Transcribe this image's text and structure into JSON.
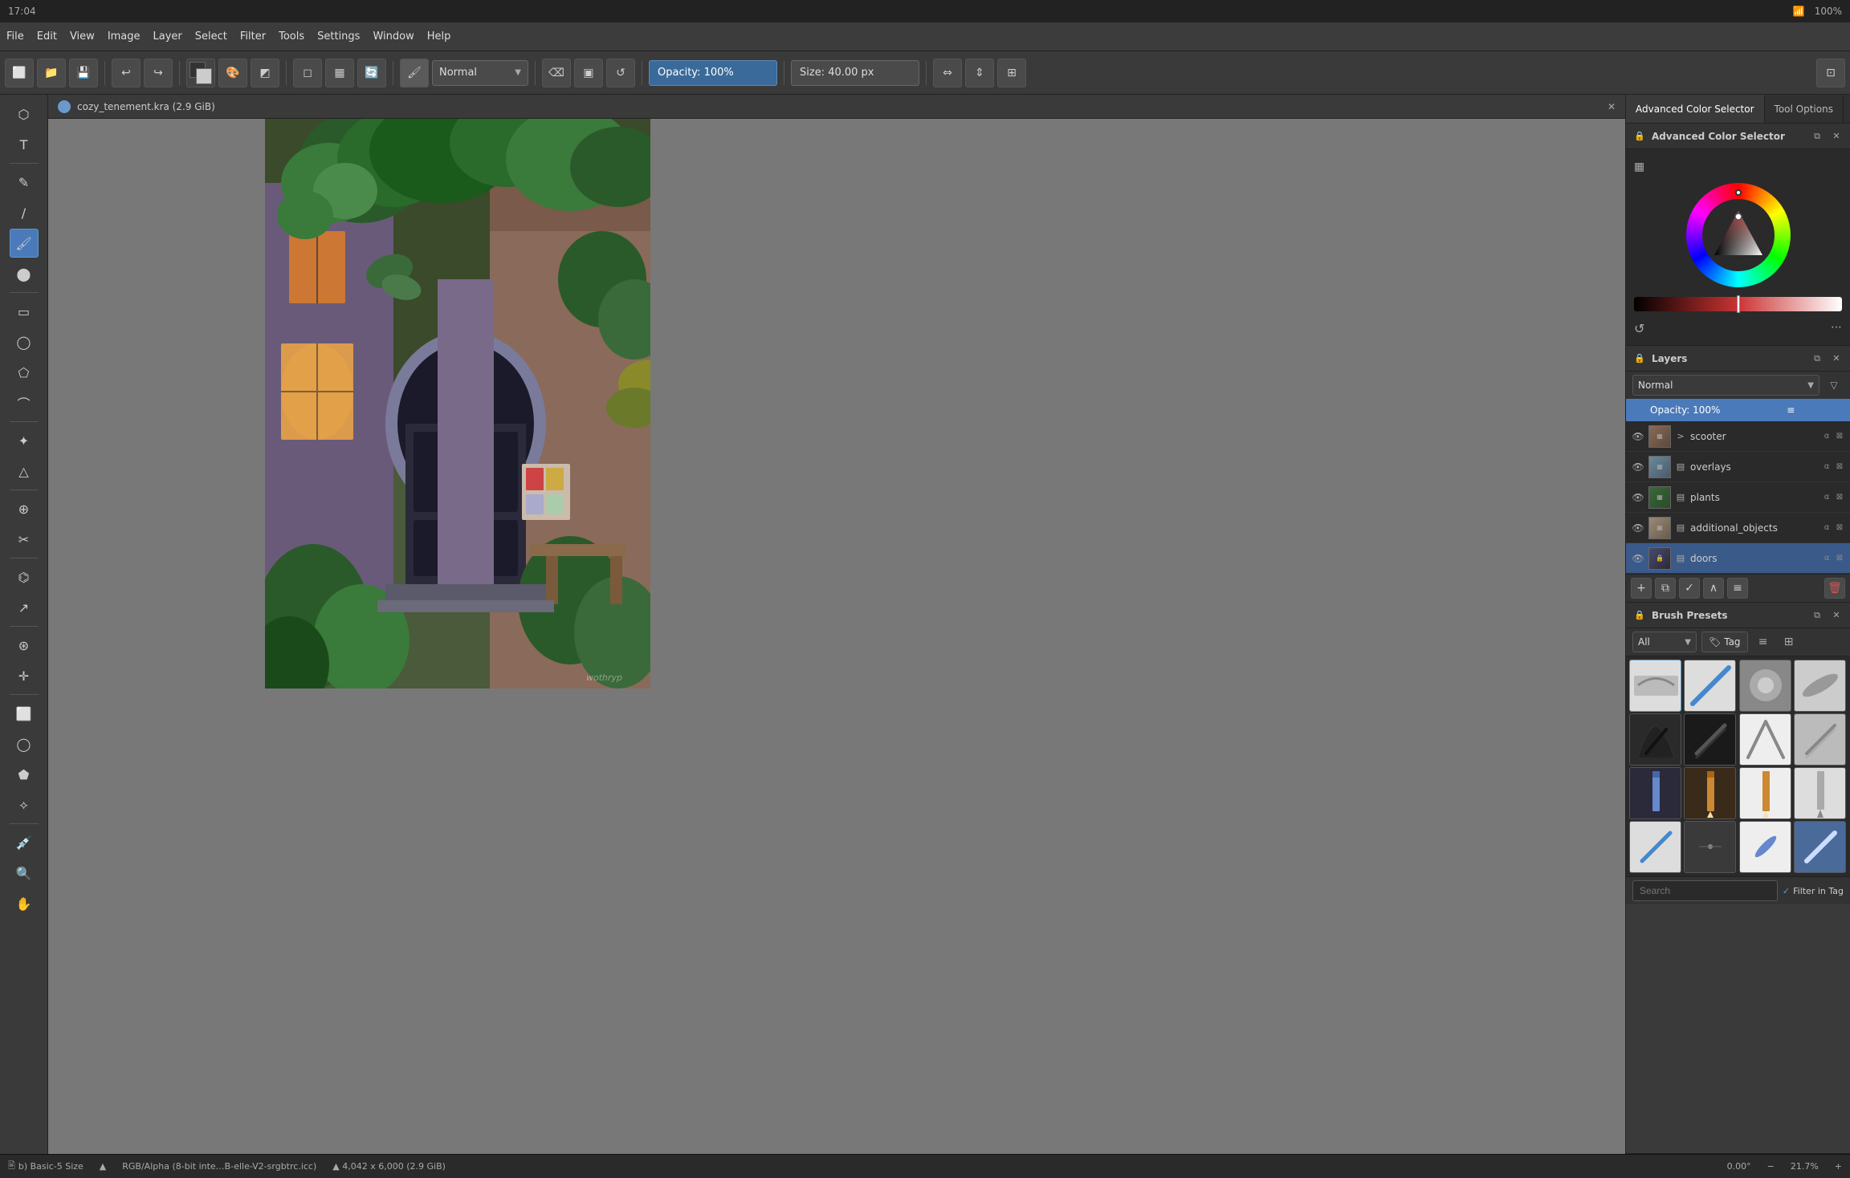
{
  "titlebar": {
    "time": "17:04",
    "battery": "100%"
  },
  "menubar": {
    "items": [
      "File",
      "Edit",
      "View",
      "Image",
      "Layer",
      "Select",
      "Filter",
      "Tools",
      "Settings",
      "Window",
      "Help"
    ]
  },
  "toolbar": {
    "blend_mode": "Normal",
    "opacity_label": "Opacity: 100%",
    "size_label": "Size: 40.00 px",
    "brush_name": "b) Basic-5 Size"
  },
  "canvas": {
    "tab_title": "cozy_tenement.kra (2.9 GiB)",
    "color_profile": "RGB/Alpha (8-bit inte…B-elle-V2-srgbtrc.icc)",
    "dimensions": "4,042 x 6,000 (2.9 GiB)",
    "rotation": "0.00°",
    "zoom": "21.7%"
  },
  "color_selector": {
    "title": "Advanced Color Selector",
    "panel_title": "Advanced Color Selector"
  },
  "tool_options": {
    "title": "Tool Options"
  },
  "layers": {
    "title": "Layers",
    "blend_mode": "Normal",
    "opacity_label": "Opacity:  100%",
    "items": [
      {
        "name": "scooter",
        "visible": true,
        "active": false
      },
      {
        "name": "overlays",
        "visible": true,
        "active": false
      },
      {
        "name": "plants",
        "visible": true,
        "active": false
      },
      {
        "name": "additional_objects",
        "visible": true,
        "active": false
      },
      {
        "name": "doors",
        "visible": true,
        "active": true
      }
    ]
  },
  "brush_presets": {
    "title": "Brush Presets",
    "filter_all": "All",
    "tag_label": "Tag",
    "search_placeholder": "Search",
    "filter_in_tag": "Filter in Tag"
  },
  "statusbar": {
    "brush": "b) Basic-5 Size",
    "color_profile": "RGB/Alpha (8-bit inte…B-elle-V2-srgbtrc.icc)",
    "dimensions": "▲ 4,042 x 6,000 (2.9 GiB)",
    "rotation": "0.00°",
    "zoom": "21.7%"
  }
}
